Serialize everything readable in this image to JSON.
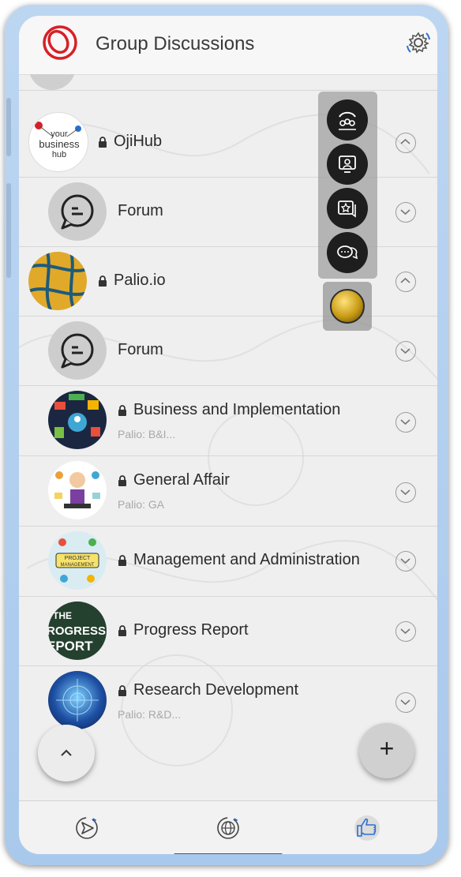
{
  "header": {
    "title": "Group Discussions",
    "logo_icon": "brand-logo-icon",
    "settings_icon": "settings-gear-icon"
  },
  "colors": {
    "brand_red": "#d81f26",
    "text": "#2b2b2b",
    "subtext": "#a8a8a8",
    "background": "#efefef"
  },
  "rows": [
    {
      "title": "OjiHub",
      "locked": true,
      "chevron": "up",
      "avatar_text": "your business hub"
    },
    {
      "title": "Forum",
      "locked": false,
      "chevron": "down"
    },
    {
      "title": "Palio.io",
      "locked": true,
      "chevron": "up"
    },
    {
      "title": "Forum",
      "locked": false,
      "chevron": "down"
    },
    {
      "title": "Business and Implementation",
      "subtitle": "Palio: B&I...",
      "locked": true,
      "chevron": "down"
    },
    {
      "title": "General Affair",
      "subtitle": "Palio: GA",
      "locked": true,
      "chevron": "down"
    },
    {
      "title": "Management and Administration",
      "locked": true,
      "chevron": "down",
      "avatar_text": "PROJECT MANAGEMENT"
    },
    {
      "title": "Progress Report",
      "locked": true,
      "chevron": "down",
      "avatar_text": "THE PROGRESS REPORT"
    },
    {
      "title": "Research Development",
      "subtitle": "Palio: R&D...",
      "locked": true,
      "chevron": "down"
    }
  ],
  "floating_menu": [
    "contact-center-icon",
    "video-call-icon",
    "starred-chat-icon",
    "chat-bubbles-icon"
  ],
  "fabs": {
    "scroll_up_icon": "chevron-up-icon",
    "add_label": "+"
  },
  "bottom_nav": [
    "send-icon",
    "globe-icon",
    "thumbs-up-icon"
  ]
}
